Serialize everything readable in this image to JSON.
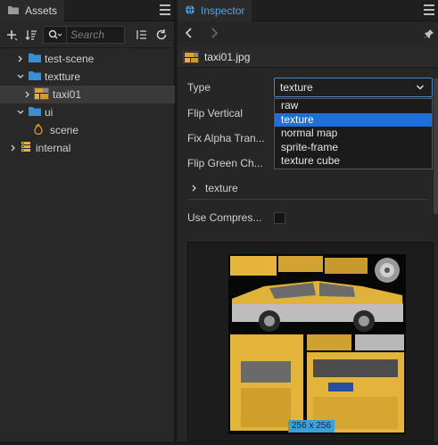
{
  "assets": {
    "tab_label": "Assets",
    "search_placeholder": "Search",
    "tree": [
      {
        "label": "test-scene",
        "icon": "folder-icon",
        "expanded": false
      },
      {
        "label": "textture",
        "icon": "folder-icon",
        "expanded": true
      },
      {
        "label": "taxi01",
        "icon": "image-icon",
        "expanded": false,
        "selected": true
      },
      {
        "label": "ui",
        "icon": "folder-icon",
        "expanded": true
      },
      {
        "label": "scene",
        "icon": "scene-fire-icon",
        "expanded": false
      },
      {
        "label": "internal",
        "icon": "db-icon",
        "expanded": false
      }
    ]
  },
  "inspector": {
    "tab_label": "Inspector",
    "file_name": "taxi01.jpg",
    "type_label": "Type",
    "type_value": "texture",
    "type_options": [
      "raw",
      "texture",
      "normal map",
      "sprite-frame",
      "texture cube"
    ],
    "flip_vertical_label": "Flip Vertical",
    "fix_alpha_label": "Fix Alpha Tran...",
    "flip_green_label": "Flip Green Ch...",
    "subsection_label": "texture",
    "use_compress_label": "Use Compres...",
    "preview_size": "256 x 256"
  },
  "colors": {
    "accent": "#1e6fd9",
    "tab_accent": "#4aa6e8",
    "folder": "#3b8fd1",
    "badge": "#3d9fd6"
  }
}
